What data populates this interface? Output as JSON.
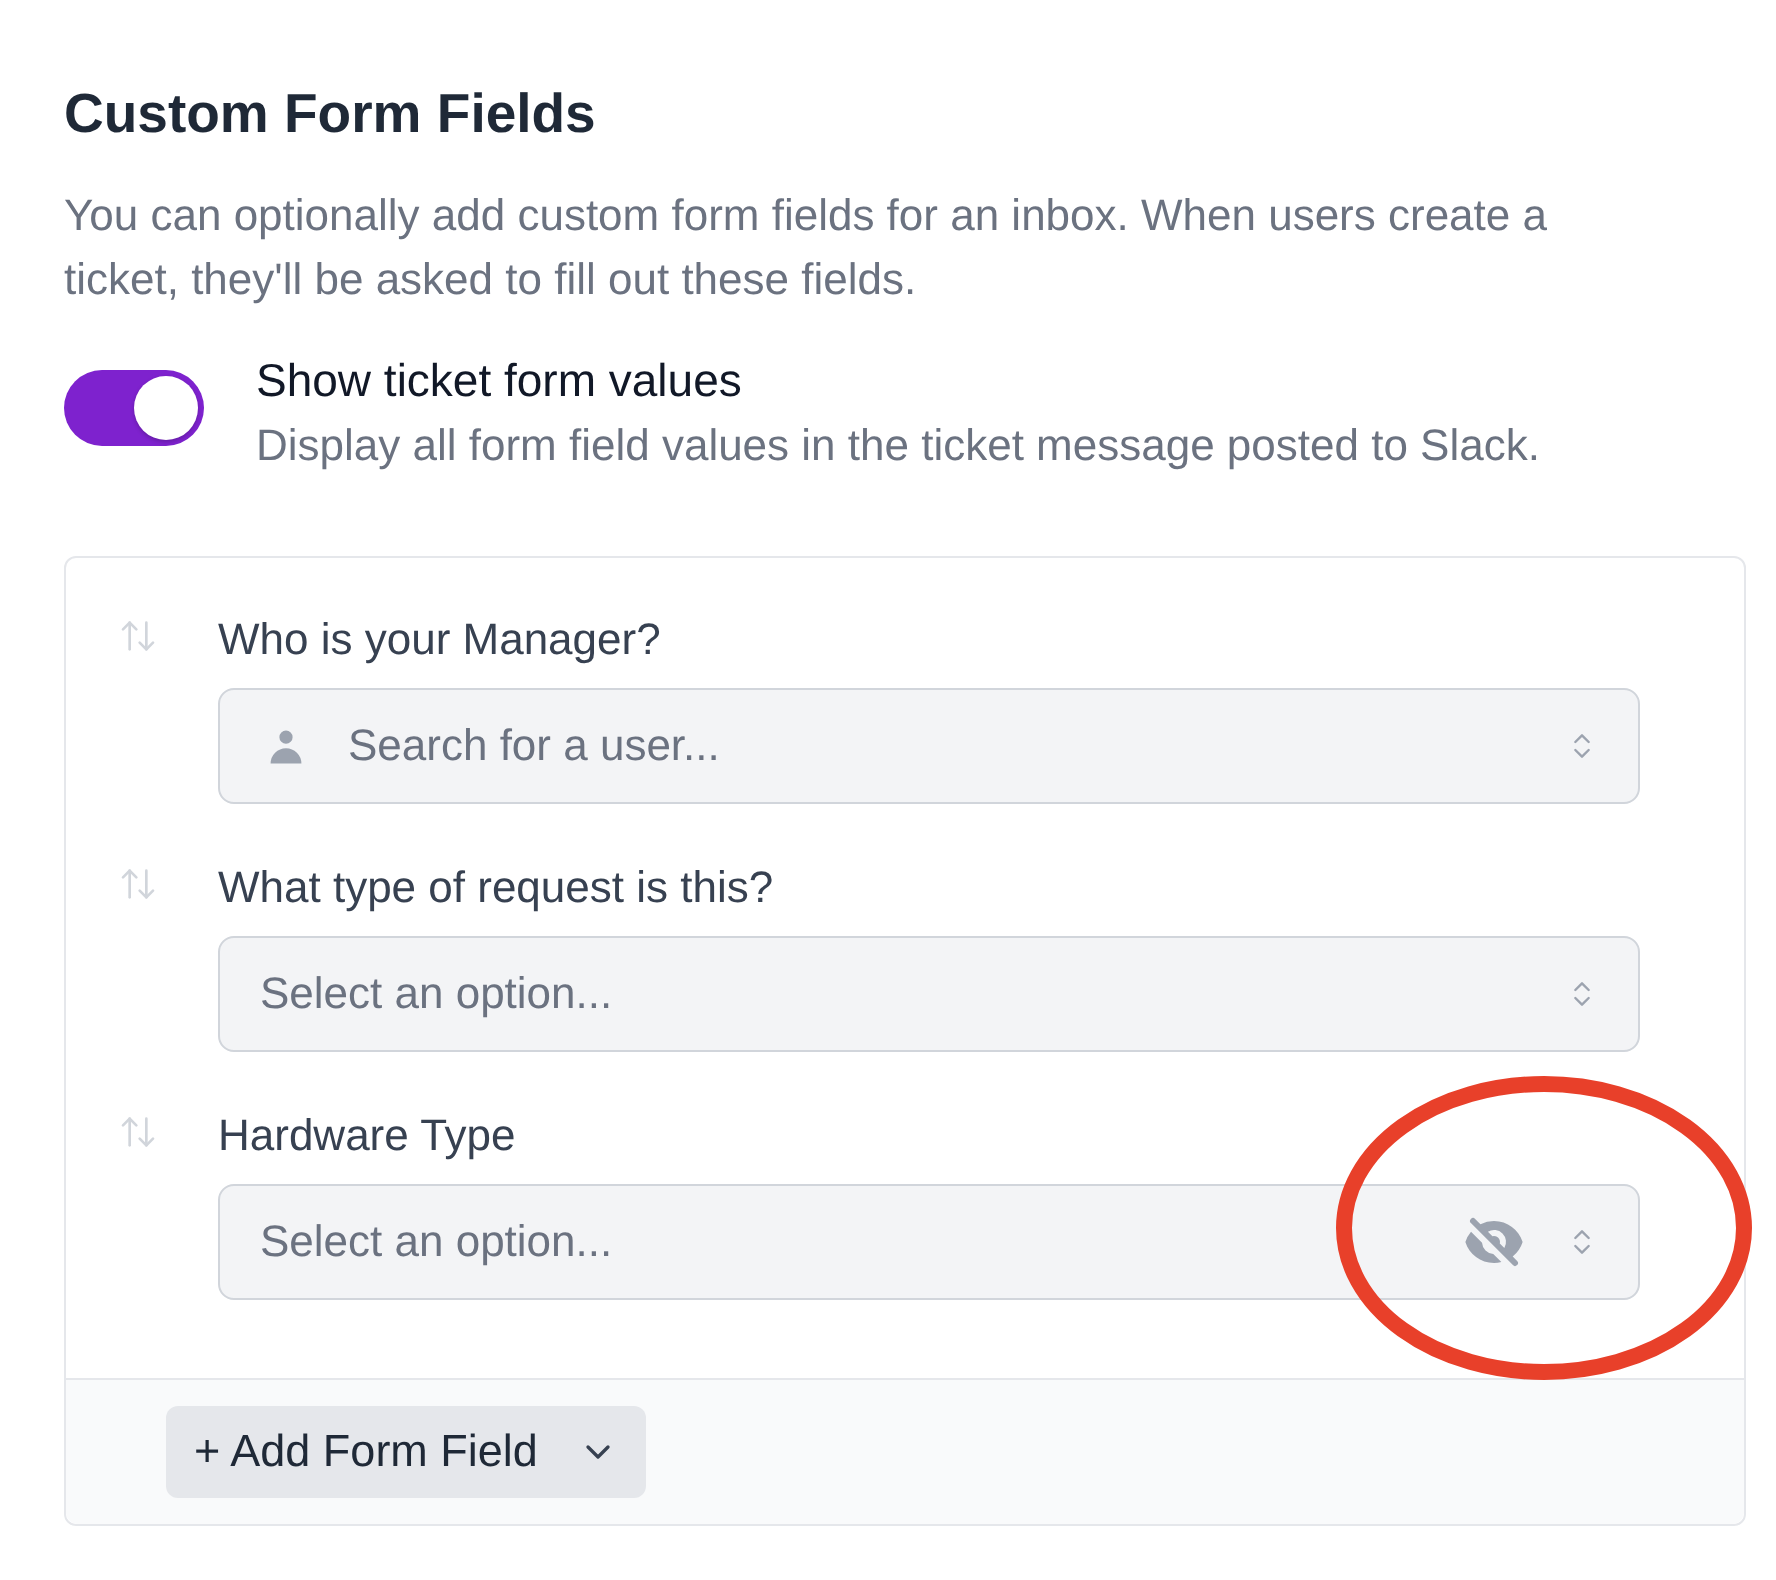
{
  "section": {
    "title": "Custom Form Fields",
    "description": "You can optionally add custom form fields for an inbox. When users create a ticket, they'll be asked to fill out these fields."
  },
  "toggle": {
    "label": "Show ticket form values",
    "description": "Display all form field values in the ticket message posted to Slack.",
    "on": true
  },
  "fields": [
    {
      "label": "Who is your Manager?",
      "kind": "user",
      "placeholder": "Search for a user...",
      "hidden": false,
      "highlighted": false
    },
    {
      "label": "What type of request is this?",
      "kind": "select",
      "placeholder": "Select an option...",
      "hidden": false,
      "highlighted": false
    },
    {
      "label": "Hardware Type",
      "kind": "select",
      "placeholder": "Select an option...",
      "hidden": true,
      "highlighted": true
    }
  ],
  "add_button": {
    "label": "+ Add Form Field"
  }
}
